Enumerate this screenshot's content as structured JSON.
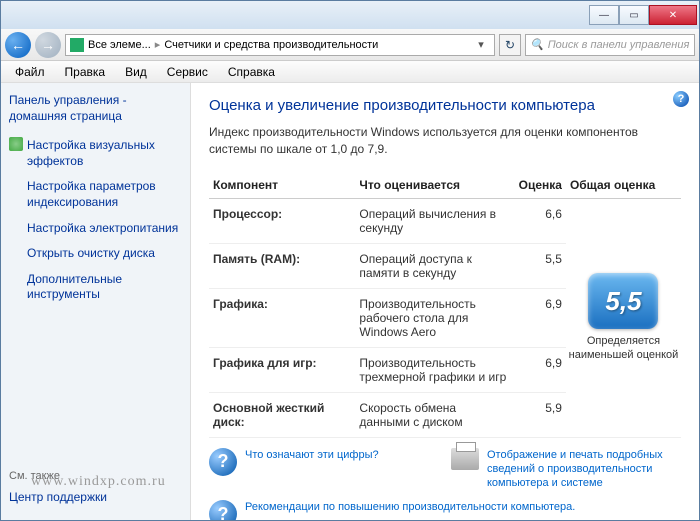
{
  "titlebar": {
    "min": "—",
    "max": "▭",
    "close": "✕"
  },
  "nav": {
    "crumb1": "Все элеме...",
    "crumb2": "Счетчики и средства производительности",
    "search_placeholder": "Поиск в панели управления"
  },
  "menu": {
    "file": "Файл",
    "edit": "Правка",
    "view": "Вид",
    "tools": "Сервис",
    "help": "Справка"
  },
  "sidebar": {
    "home": "Панель управления - домашняя страница",
    "links": [
      "Настройка визуальных эффектов",
      "Настройка параметров индексирования",
      "Настройка электропитания",
      "Открыть очистку диска",
      "Дополнительные инструменты"
    ],
    "also_label": "См. также",
    "also_link": "Центр поддержки"
  },
  "main": {
    "title": "Оценка и увеличение производительности компьютера",
    "desc": "Индекс производительности Windows используется для оценки компонентов системы по шкале от 1,0 до 7,9.",
    "headers": {
      "component": "Компонент",
      "what": "Что оценивается",
      "score": "Оценка",
      "base": "Общая оценка"
    },
    "rows": [
      {
        "name": "Процессор:",
        "what": "Операций вычисления в секунду",
        "score": "6,6"
      },
      {
        "name": "Память (RAM):",
        "what": "Операций доступа к памяти в секунду",
        "score": "5,5"
      },
      {
        "name": "Графика:",
        "what": "Производительность рабочего стола для Windows Aero",
        "score": "6,9"
      },
      {
        "name": "Графика для игр:",
        "what": "Производительность трехмерной графики и игр",
        "score": "6,9"
      },
      {
        "name": "Основной жесткий диск:",
        "what": "Скорость обмена данными с диском",
        "score": "5,9"
      }
    ],
    "base_score": "5,5",
    "base_caption": "Определяется наименьшей оценкой",
    "link_what": "Что означают эти цифры?",
    "link_print": "Отображение и печать подробных сведений о производительности компьютера и системе",
    "link_reco": "Рекомендации по повышению производительности компьютера."
  },
  "watermark": "www.windxp.com.ru"
}
